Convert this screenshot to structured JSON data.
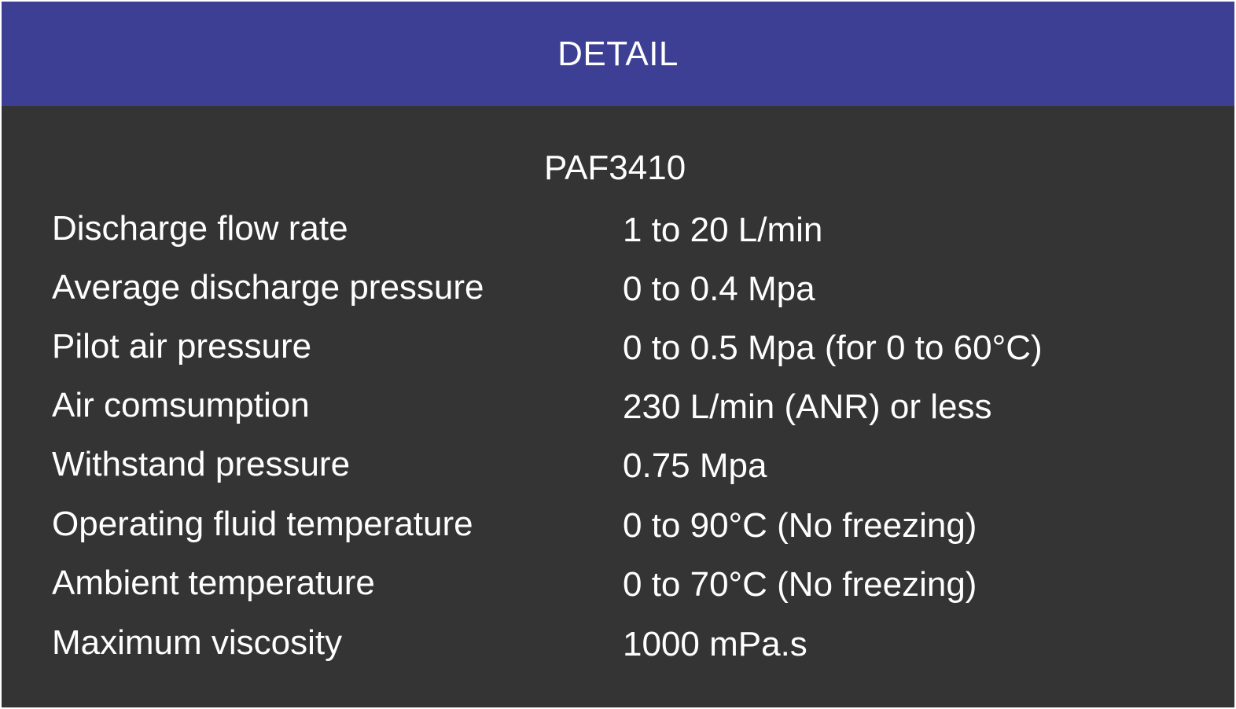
{
  "header": {
    "title": "DETAIL"
  },
  "model": "PAF3410",
  "specs": [
    {
      "label": "Discharge flow rate",
      "value": "1 to 20 L/min"
    },
    {
      "label": "Average discharge pressure",
      "value": "0 to 0.4 Mpa"
    },
    {
      "label": "Pilot air pressure",
      "value": "0 to 0.5 Mpa (for 0 to 60°C)"
    },
    {
      "label": "Air comsumption",
      "value": "230 L/min (ANR) or less"
    },
    {
      "label": "Withstand pressure",
      "value": "0.75 Mpa"
    },
    {
      "label": "Operating fluid temperature",
      "value": "0 to 90°C (No freezing)"
    },
    {
      "label": "Ambient temperature",
      "value": "0 to 70°C (No freezing)"
    },
    {
      "label": "Maximum viscosity",
      "value": "1000 mPa.s"
    }
  ],
  "colors": {
    "header_background": "#3d3f94",
    "body_background": "#353435",
    "text": "#ffffff"
  }
}
